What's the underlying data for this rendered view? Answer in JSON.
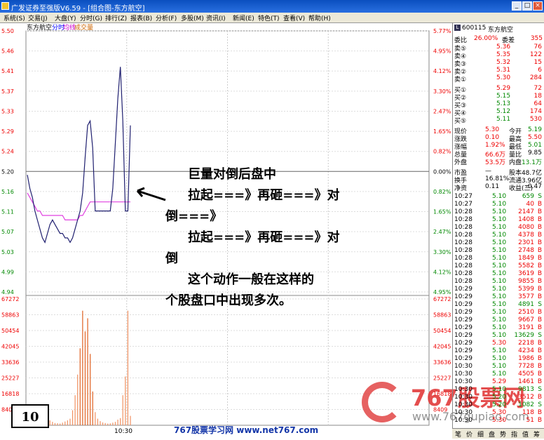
{
  "window": {
    "title": "广发证券至强版V6.59 - [组合图-东方航空]"
  },
  "menu": [
    "系统(S)",
    "交易(J)",
    "大盘(Y)",
    "分时(G)",
    "排行(Z)",
    "报表(B)",
    "分析(F)",
    "多股(M)",
    "资讯(I)",
    "新闻(E)",
    "特色(T)",
    "查看(V)",
    "帮助(H)"
  ],
  "chart": {
    "stock_name": "东方航空",
    "legend": {
      "time": "分时",
      "avg": "均线",
      "volume": "成交量"
    },
    "time_tick": "10:30"
  },
  "chart_data": {
    "type": "line",
    "price_ticks": [
      "5.50",
      "5.46",
      "5.41",
      "5.37",
      "5.33",
      "5.29",
      "5.24",
      "5.20",
      "5.16",
      "5.11",
      "5.07",
      "5.03",
      "4.99",
      "4.94"
    ],
    "pct_ticks": [
      "5.77%",
      "4.95%",
      "4.12%",
      "3.30%",
      "2.47%",
      "1.65%",
      "0.82%",
      "0.00%",
      "0.82%",
      "1.65%",
      "2.47%",
      "3.30%",
      "4.12%",
      "4.95%"
    ],
    "vol_ticks": [
      "67272",
      "58863",
      "50454",
      "42045",
      "33636",
      "25227",
      "16818",
      "8409"
    ],
    "ylim": [
      4.92,
      5.5
    ],
    "prev_close": 5.2,
    "price": [
      5.18,
      5.15,
      5.13,
      5.1,
      5.08,
      5.06,
      5.04,
      5.03,
      5.05,
      5.07,
      5.08,
      5.07,
      5.06,
      5.05,
      5.05,
      5.04,
      5.04,
      5.03,
      5.04,
      5.06,
      5.08,
      5.1,
      5.14,
      5.22,
      5.29,
      5.3,
      5.24,
      5.1,
      5.1,
      5.1,
      5.1,
      5.1,
      5.1,
      5.1,
      5.15,
      5.25,
      5.35,
      5.42,
      5.3,
      5.1,
      5.1,
      5.29
    ],
    "avg": [
      5.14,
      5.13,
      5.12,
      5.11,
      5.1,
      5.1,
      5.09,
      5.09,
      5.09,
      5.09,
      5.09,
      5.09,
      5.09,
      5.09,
      5.09,
      5.08,
      5.08,
      5.08,
      5.08,
      5.08,
      5.08,
      5.09,
      5.09,
      5.1,
      5.11,
      5.12,
      5.12,
      5.12,
      5.12,
      5.12,
      5.12,
      5.12,
      5.12,
      5.12,
      5.12,
      5.12,
      5.12,
      5.12,
      5.12,
      5.12,
      5.12,
      5.12
    ],
    "volume": [
      900,
      1200,
      1500,
      1100,
      800,
      700,
      1000,
      900,
      1400,
      2600,
      1800,
      1200,
      1100,
      900,
      1400,
      2000,
      2600,
      3500,
      8000,
      16000,
      27000,
      41000,
      61000,
      50000,
      57000,
      38000,
      18000,
      7000,
      3500,
      2200,
      1500,
      1200,
      900,
      1000,
      1400,
      1800,
      3000,
      3800,
      16000,
      26000,
      61000,
      5000
    ],
    "vol_max": 67272
  },
  "quote": {
    "code": "600115",
    "name": "东方航空",
    "weibi_label": "委比",
    "weibi": "26.00%",
    "weicha_label": "委差",
    "weicha": "355",
    "sells": [
      {
        "label": "卖⑤",
        "price": "5.36",
        "vol": "76"
      },
      {
        "label": "卖④",
        "price": "5.35",
        "vol": "122"
      },
      {
        "label": "卖③",
        "price": "5.32",
        "vol": "15"
      },
      {
        "label": "卖②",
        "price": "5.31",
        "vol": "6"
      },
      {
        "label": "卖①",
        "price": "5.30",
        "vol": "284"
      }
    ],
    "buys": [
      {
        "label": "买①",
        "price": "5.29",
        "vol": "72"
      },
      {
        "label": "买②",
        "price": "5.15",
        "vol": "18"
      },
      {
        "label": "买③",
        "price": "5.13",
        "vol": "64"
      },
      {
        "label": "买④",
        "price": "5.12",
        "vol": "174"
      },
      {
        "label": "买⑤",
        "price": "5.11",
        "vol": "530"
      }
    ],
    "stats": [
      {
        "l1": "现价",
        "v1": "5.30",
        "l2": "今开",
        "v2": "5.19",
        "c1": "red",
        "c2": "grn"
      },
      {
        "l1": "涨跌",
        "v1": "0.10",
        "l2": "最高",
        "v2": "5.50",
        "c1": "red",
        "c2": "red"
      },
      {
        "l1": "涨幅",
        "v1": "1.92%",
        "l2": "最低",
        "v2": "5.01",
        "c1": "red",
        "c2": "grn"
      },
      {
        "l1": "总量",
        "v1": "66.6万",
        "l2": "量比",
        "v2": "9.85",
        "c1": "red",
        "c2": "blk"
      },
      {
        "l1": "外盘",
        "v1": "53.5万",
        "l2": "内盘",
        "v2": "13.1万",
        "c1": "red",
        "c2": "grn"
      }
    ],
    "fund": [
      {
        "l1": "市盈",
        "v1": "—",
        "l2": "股本",
        "v2": "48.7亿"
      },
      {
        "l1": "换手",
        "v1": "16.81%",
        "l2": "流通",
        "v2": "3.96亿"
      },
      {
        "l1": "净资",
        "v1": "0.11",
        "l2": "收益(三)",
        "v2": "-0.47"
      }
    ],
    "ticks": [
      {
        "t": "10:27",
        "p": "5.10",
        "v": "659",
        "s": "S"
      },
      {
        "t": "10:27",
        "p": "5.10",
        "v": "40",
        "s": "B"
      },
      {
        "t": "10:28",
        "p": "5.10",
        "v": "2147",
        "s": "B"
      },
      {
        "t": "10:28",
        "p": "5.10",
        "v": "1408",
        "s": "B"
      },
      {
        "t": "10:28",
        "p": "5.10",
        "v": "4080",
        "s": "B"
      },
      {
        "t": "10:28",
        "p": "5.10",
        "v": "4378",
        "s": "B"
      },
      {
        "t": "10:28",
        "p": "5.10",
        "v": "2301",
        "s": "B"
      },
      {
        "t": "10:28",
        "p": "5.10",
        "v": "2748",
        "s": "B"
      },
      {
        "t": "10:28",
        "p": "5.10",
        "v": "1849",
        "s": "B"
      },
      {
        "t": "10:28",
        "p": "5.10",
        "v": "5582",
        "s": "B"
      },
      {
        "t": "10:28",
        "p": "5.10",
        "v": "3619",
        "s": "B"
      },
      {
        "t": "10:28",
        "p": "5.10",
        "v": "9855",
        "s": "B"
      },
      {
        "t": "10:29",
        "p": "5.10",
        "v": "5399",
        "s": "B"
      },
      {
        "t": "10:29",
        "p": "5.10",
        "v": "3577",
        "s": "B"
      },
      {
        "t": "10:29",
        "p": "5.10",
        "v": "4891",
        "s": "S"
      },
      {
        "t": "10:29",
        "p": "5.10",
        "v": "2510",
        "s": "B"
      },
      {
        "t": "10:29",
        "p": "5.10",
        "v": "9667",
        "s": "B"
      },
      {
        "t": "10:29",
        "p": "5.10",
        "v": "3191",
        "s": "B"
      },
      {
        "t": "10:29",
        "p": "5.10",
        "v": "13629",
        "s": "S"
      },
      {
        "t": "10:29",
        "p": "5.30",
        "v": "2218",
        "s": "B"
      },
      {
        "t": "10:29",
        "p": "5.10",
        "v": "4234",
        "s": "B"
      },
      {
        "t": "10:29",
        "p": "5.10",
        "v": "1986",
        "s": "B"
      },
      {
        "t": "10:30",
        "p": "5.10",
        "v": "7728",
        "s": "B"
      },
      {
        "t": "10:30",
        "p": "5.10",
        "v": "4505",
        "s": "B"
      },
      {
        "t": "10:30",
        "p": "5.29",
        "v": "1461",
        "s": "B"
      },
      {
        "t": "10:30",
        "p": "5.10",
        "v": "9813",
        "s": "S"
      },
      {
        "t": "10:30",
        "p": "5.20",
        "v": "3512",
        "s": "B"
      },
      {
        "t": "10:30",
        "p": "5.20",
        "v": "1082",
        "s": "S"
      },
      {
        "t": "10:30",
        "p": "5.30",
        "v": "118",
        "s": "B"
      },
      {
        "t": "10:30",
        "p": "5.30",
        "v": "51",
        "s": "B"
      }
    ],
    "tabs": [
      "笔",
      "价",
      "细",
      "盘",
      "势",
      "指",
      "值",
      "筹"
    ]
  },
  "annotation": {
    "line1": "巨量对倒后盘中",
    "line2": "拉起===》再砸===》对",
    "line3": "倒===》",
    "line4": "拉起===》再砸===》对",
    "line5": "倒",
    "line6": "这个动作一般在这样的",
    "line7": "个股盘口中出现多次。"
  },
  "page_number": "10",
  "footer": "767股票学习网 www.net767.com",
  "watermark": {
    "brand": "767股票网",
    "url": "www.767gupiao.com"
  }
}
